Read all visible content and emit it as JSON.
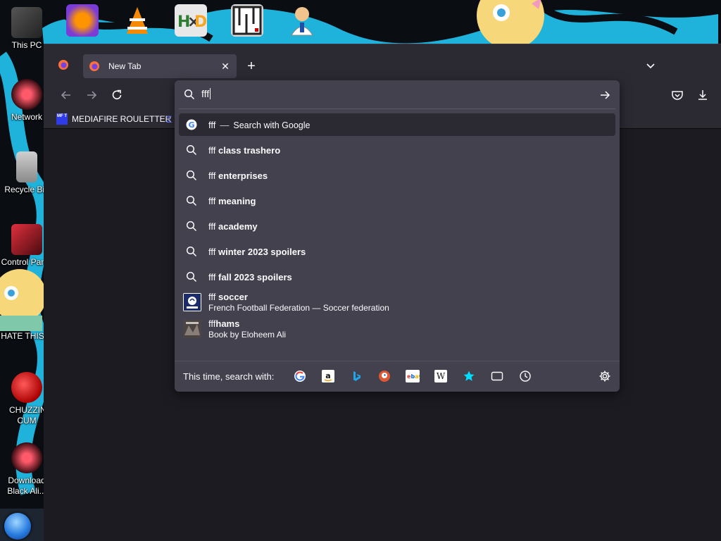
{
  "desktop": {
    "icons": [
      {
        "label": "This PC"
      },
      {
        "label": "Network"
      },
      {
        "label": "Recycle Bin"
      },
      {
        "label": "Control Panel"
      },
      {
        "label": "HATE THIS C"
      },
      {
        "label": "CHUZZIN CUM"
      },
      {
        "label": "Download Black Ali..."
      }
    ]
  },
  "browser": {
    "tab": {
      "title": "New Tab",
      "close_glyph": "✕"
    },
    "new_tab_glyph": "+",
    "bookmarks": [
      {
        "label": "MEDIAFIRE ROULETTER",
        "icon_text": "MF T"
      }
    ],
    "urlbar": {
      "value": "fff",
      "results": [
        {
          "type": "search-engine",
          "text": "fff",
          "dash": "—",
          "action": "Search with Google",
          "icon": "google-icon",
          "selected": true
        },
        {
          "type": "suggestion",
          "prefix": "fff ",
          "bold": "class trashero",
          "icon": "search-icon"
        },
        {
          "type": "suggestion",
          "prefix": "fff ",
          "bold": "enterprises",
          "icon": "search-icon"
        },
        {
          "type": "suggestion",
          "prefix": "fff ",
          "bold": "meaning",
          "icon": "search-icon"
        },
        {
          "type": "suggestion",
          "prefix": "fff ",
          "bold": "academy",
          "icon": "search-icon"
        },
        {
          "type": "suggestion",
          "prefix": "fff ",
          "bold": "winter 2023 spoilers",
          "icon": "search-icon"
        },
        {
          "type": "suggestion",
          "prefix": "fff ",
          "bold": "fall 2023 spoilers",
          "icon": "search-icon"
        },
        {
          "type": "rich",
          "prefix": "fff ",
          "bold": "soccer",
          "subtitle": "French Football Federation — Soccer federation",
          "thumb": "fff-crest-icon"
        },
        {
          "type": "rich",
          "prefix": "fff",
          "bold": "hams",
          "subtitle": "Book by Eloheem Ali",
          "thumb": "book-cover-icon"
        }
      ],
      "oneoff_label": "This time, search with:",
      "engines": [
        "google",
        "amazon",
        "bing",
        "duckduckgo",
        "ebay",
        "wikipedia",
        "bookmarks",
        "tabs",
        "history"
      ]
    }
  },
  "colors": {
    "toolbar": "#2b2a33",
    "panel": "#42414d",
    "content": "#1c1b22",
    "text": "#fbfbfe",
    "wallpaper_accent": "#22b8e0"
  }
}
